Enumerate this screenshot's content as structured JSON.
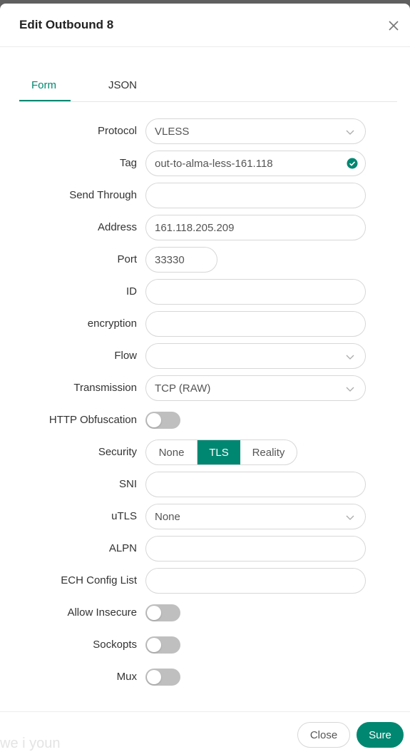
{
  "dialog": {
    "title": "Edit Outbound 8"
  },
  "tabs": [
    {
      "label": "Form"
    },
    {
      "label": "JSON"
    }
  ],
  "fields": {
    "protocol": {
      "label": "Protocol",
      "value": "VLESS"
    },
    "tag": {
      "label": "Tag",
      "value": "out-to-alma-less-161.118"
    },
    "send_through": {
      "label": "Send Through",
      "value": ""
    },
    "address": {
      "label": "Address",
      "value": "161.118.205.209"
    },
    "port": {
      "label": "Port",
      "value": "33330"
    },
    "id": {
      "label": "ID",
      "value": ""
    },
    "encryption": {
      "label": "encryption",
      "value": ""
    },
    "flow": {
      "label": "Flow",
      "value": ""
    },
    "transmission": {
      "label": "Transmission",
      "value": "TCP (RAW)"
    },
    "http_obfuscation": {
      "label": "HTTP Obfuscation",
      "on": false
    },
    "security": {
      "label": "Security",
      "options": [
        "None",
        "TLS",
        "Reality"
      ],
      "selected": "TLS"
    },
    "sni": {
      "label": "SNI",
      "value": ""
    },
    "utls": {
      "label": "uTLS",
      "value": "None"
    },
    "alpn": {
      "label": "ALPN",
      "value": ""
    },
    "ech_config_list": {
      "label": "ECH Config List",
      "value": ""
    },
    "allow_insecure": {
      "label": "Allow Insecure",
      "on": false
    },
    "sockopts": {
      "label": "Sockopts",
      "on": false
    },
    "mux": {
      "label": "Mux",
      "on": false
    }
  },
  "footer": {
    "close_label": "Close",
    "sure_label": "Sure"
  },
  "watermark": "we i youn",
  "colors": {
    "accent": "#008771",
    "toggle_off": "#bfbfbf",
    "overlay": "#5f5f5f"
  },
  "icons": {
    "close": "close-icon",
    "chevron": "chevron-down-icon",
    "valid": "check-circle-icon"
  }
}
